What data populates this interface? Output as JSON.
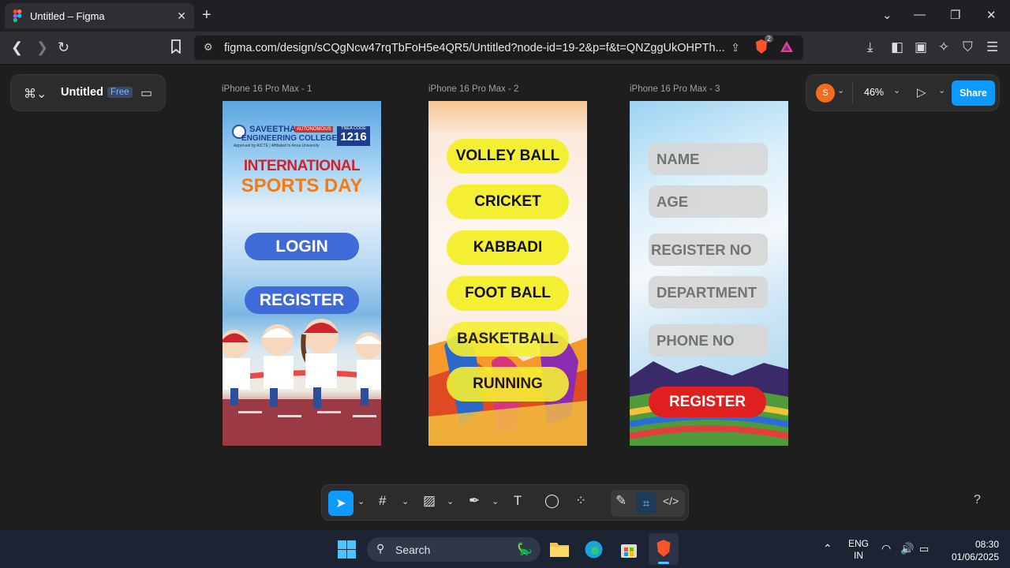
{
  "browser": {
    "tab_title": "Untitled – Figma",
    "url": "figma.com/design/sCQgNcw47rqTbFoH5e4QR5/Untitled?node-id=19-2&p=f&t=QNZggUkOHPTh...",
    "brave_badge": "2"
  },
  "figma": {
    "file_name": "Untitled",
    "plan_badge": "Free",
    "avatar_initial": "S",
    "zoom": "46%",
    "share_label": "Share",
    "help": "?"
  },
  "frames": [
    {
      "label": "iPhone 16 Pro Max - 1",
      "college_line1": "SAVEETHA",
      "college_line2": "ENGINEERING COLLEGE",
      "autonomous": "AUTONOMOUS",
      "tnea": "TNEA CODE",
      "code": "1216",
      "approved": "Approved by AICTE | Affiliated to Anna University",
      "heading1": "INTERNATIONAL",
      "heading2": "SPORTS DAY",
      "login": "LOGIN",
      "register": "REGISTER"
    },
    {
      "label": "iPhone 16 Pro Max - 2",
      "sports": [
        "VOLLEY BALL",
        "CRICKET",
        "KABBADI",
        "FOOT BALL",
        "BASKETBALL",
        "RUNNING"
      ]
    },
    {
      "label": "iPhone 16 Pro Max - 3",
      "fields": [
        "NAME",
        "AGE",
        "REGISTER NO",
        "DEPARTMENT",
        "PHONE NO"
      ],
      "register": "REGISTER"
    }
  ],
  "taskbar": {
    "search": "Search",
    "lang1": "ENG",
    "lang2": "IN",
    "time": "08:30",
    "date": "01/06/2025"
  },
  "colors": {
    "share_blue": "#0d99ff",
    "avatar_orange": "#f26c1c",
    "select_tool": "#0d99ff",
    "button_yellow": "#f5ef34",
    "button_blue": "#3f6bd9",
    "register_red": "#e02020"
  }
}
